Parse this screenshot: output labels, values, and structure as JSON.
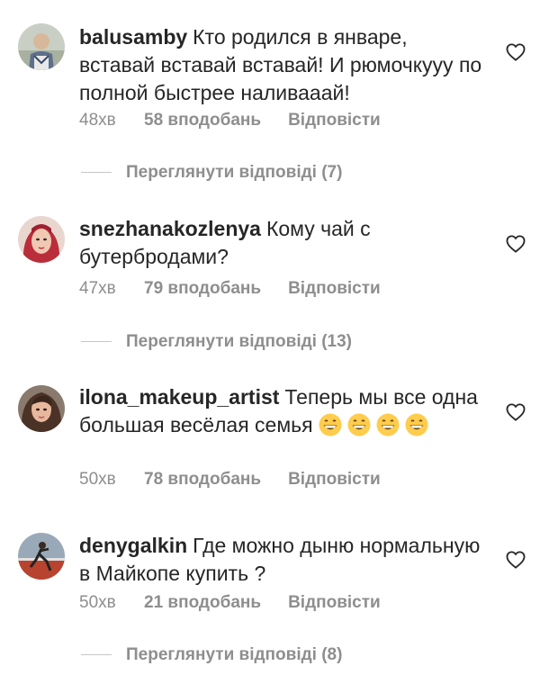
{
  "comments": [
    {
      "username": "balusamby",
      "text": "Кто родился в январе, вставай вставай вставай! И рюмочкууу по полной быстрее наливааай!",
      "time": "48хв",
      "likes": "58 вподобань",
      "reply": "Відповісти",
      "view_replies": "Переглянути відповіді (7)"
    },
    {
      "username": "snezhanakozlenya",
      "text": "Кому чай с бутербродами?",
      "time": "47хв",
      "likes": "79 вподобань",
      "reply": "Відповісти",
      "view_replies": "Переглянути відповіді (13)"
    },
    {
      "username": "ilona_makeup_artist",
      "text": "Теперь мы все одна большая весёлая семья",
      "emoji_count": 4,
      "time": "50хв",
      "likes": "78 вподобань",
      "reply": "Відповісти"
    },
    {
      "username": "denygalkin",
      "text": "Где можно дыню нормальную в Майкопе купить ?",
      "time": "50хв",
      "likes": "21 вподобань",
      "reply": "Відповісти",
      "view_replies": "Переглянути відповіді (8)"
    }
  ],
  "colors": {
    "text": "#262626",
    "muted": "#8e8e8e",
    "divider": "#c7c7c7",
    "emoji": "#ffcc4d"
  },
  "icons": {
    "like": "heart-outline-icon",
    "emoji": "grinning-face-emoji"
  }
}
